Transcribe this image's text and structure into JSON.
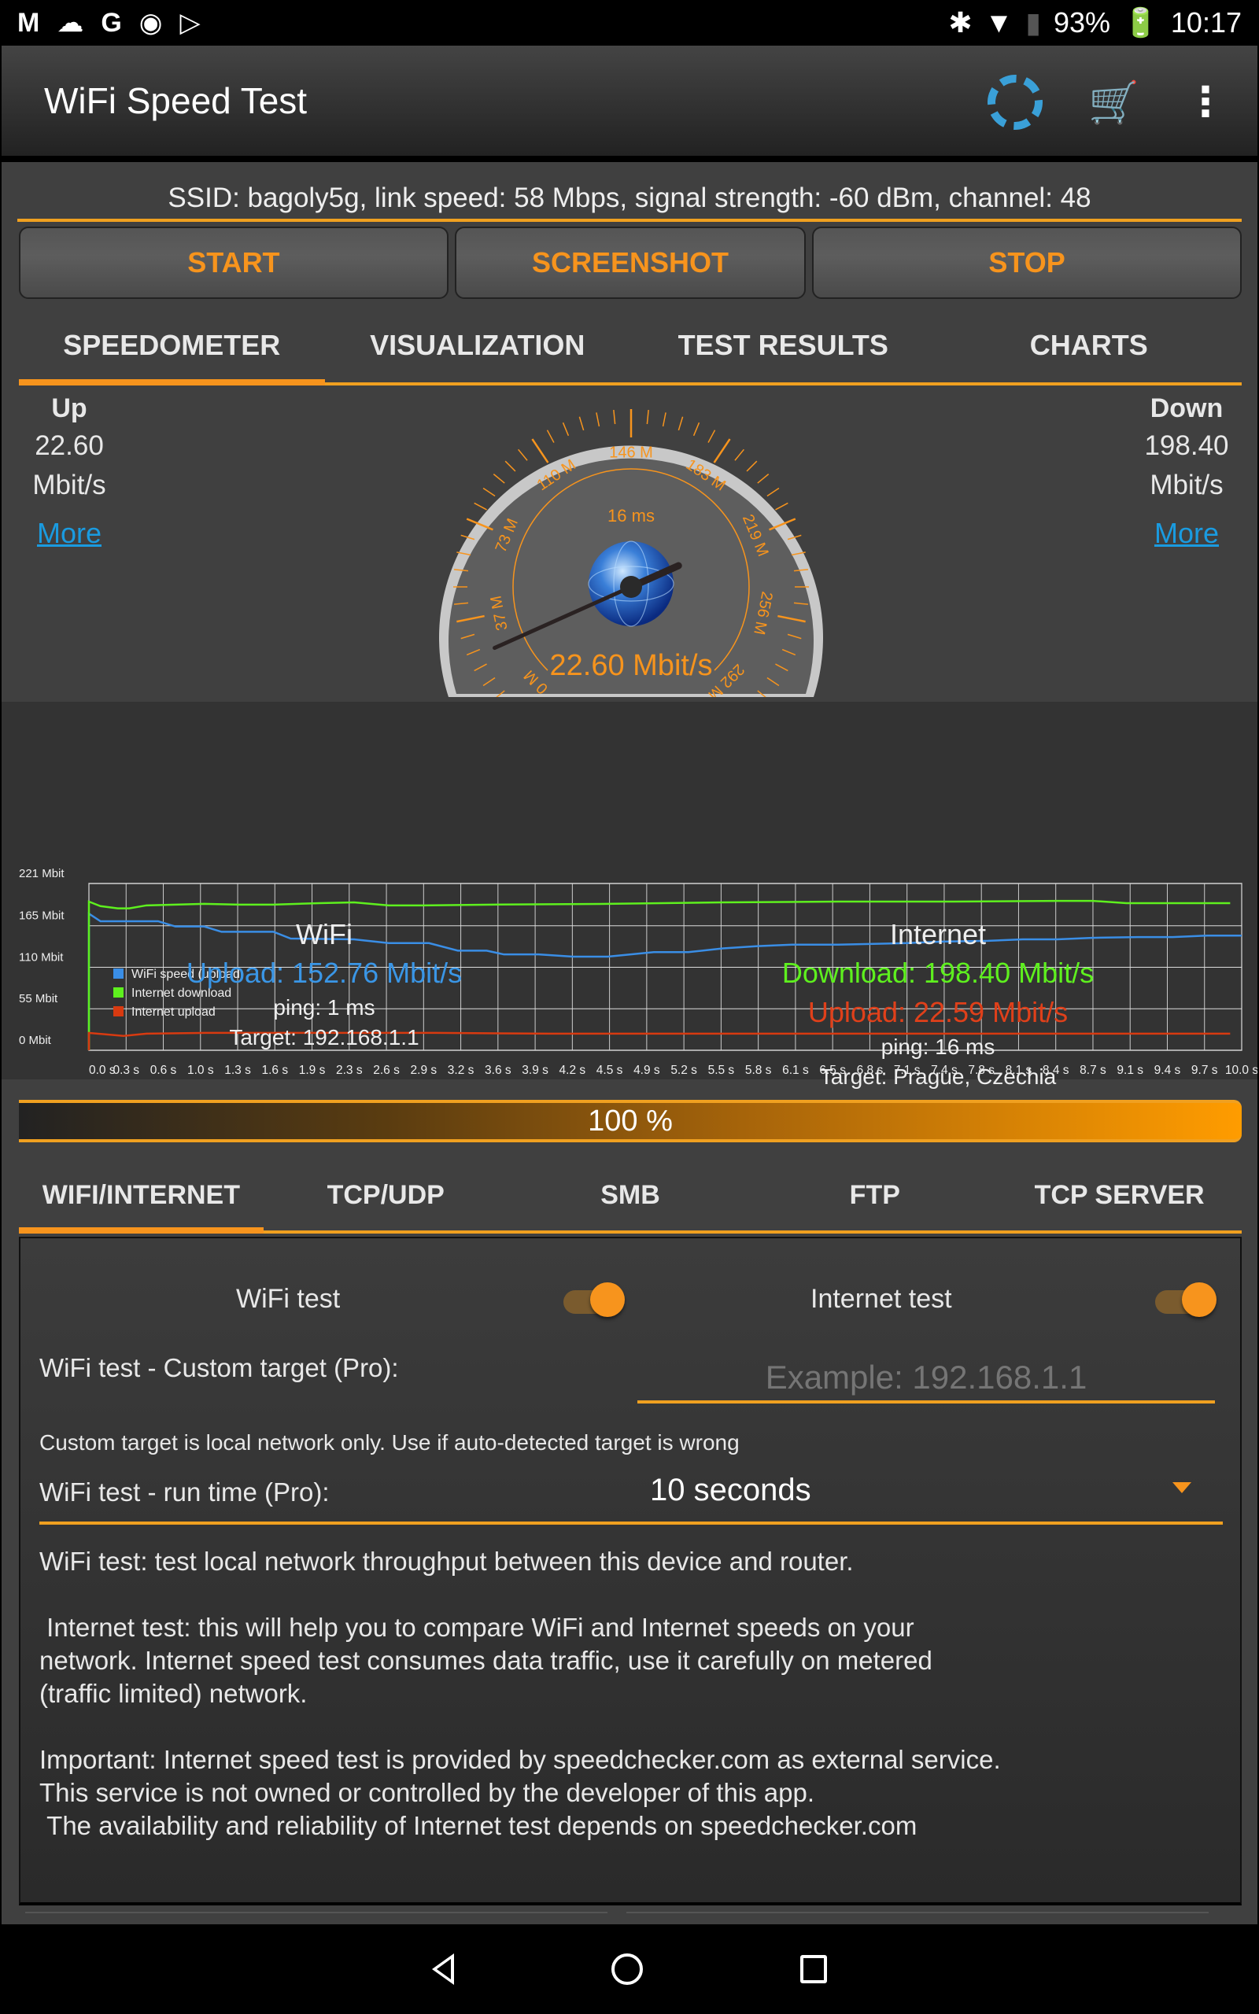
{
  "status_bar": {
    "notification_icons": [
      "gmail-icon",
      "cloud-icon",
      "google-icon",
      "circle-app-icon",
      "play-store-icon"
    ],
    "battery": "93%",
    "time": "10:17"
  },
  "app_bar": {
    "title": "WiFi Speed Test",
    "actions": [
      "settings-gear-icon",
      "cart-icon",
      "more-vert-icon"
    ]
  },
  "network_info": "SSID: bagoly5g, link speed: 58 Mbps, signal strength: -60 dBm, channel: 48",
  "buttons": {
    "start": "START",
    "screenshot": "SCREENSHOT",
    "stop": "STOP"
  },
  "top_tabs": [
    {
      "label": "SPEEDOMETER",
      "active": true
    },
    {
      "label": "VISUALIZATION",
      "active": false
    },
    {
      "label": "TEST RESULTS",
      "active": false
    },
    {
      "label": "CHARTS",
      "active": false
    }
  ],
  "speedometer": {
    "up": {
      "label": "Up",
      "value": "22.60",
      "unit": "Mbit/s",
      "more": "More"
    },
    "down": {
      "label": "Down",
      "value": "198.40",
      "unit": "Mbit/s",
      "more": "More"
    },
    "scale_labels": [
      "0 M",
      "37 M",
      "73 M",
      "110 M",
      "146 M",
      "183 M",
      "219 M",
      "256 M",
      "292 M"
    ],
    "scale_max": 292,
    "needle_value": 22.6,
    "ping": "16 ms",
    "readout": "22.60 Mbit/s",
    "accent_color": "#f7941d"
  },
  "chart_data": {
    "type": "line",
    "title": "",
    "xlabel": "",
    "ylabel": "",
    "ylim": [
      0,
      221
    ],
    "y_ticks": [
      "0 Mbit",
      "55 Mbit",
      "110 Mbit",
      "165 Mbit",
      "221 Mbit"
    ],
    "y_tick_values": [
      0,
      55,
      110,
      165,
      221
    ],
    "x_ticks": [
      "0.0 s",
      "0.3 s",
      "0.6 s",
      "1.0 s",
      "1.3 s",
      "1.6 s",
      "1.9 s",
      "2.3 s",
      "2.6 s",
      "2.9 s",
      "3.2 s",
      "3.6 s",
      "3.9 s",
      "4.2 s",
      "4.5 s",
      "4.9 s",
      "5.2 s",
      "5.5 s",
      "5.8 s",
      "6.1 s",
      "6.5 s",
      "6.8 s",
      "7.1 s",
      "7.4 s",
      "7.8 s",
      "8.1 s",
      "8.4 s",
      "8.7 s",
      "9.1 s",
      "9.4 s",
      "9.7 s",
      "10.0 s"
    ],
    "xlim": [
      0,
      10
    ],
    "grid": true,
    "legend_position": "bottom-left",
    "series": [
      {
        "name": "WiFi speed (upload)",
        "color": "#3a8ee6",
        "x": [
          0.0,
          0.1,
          0.3,
          0.6,
          0.75,
          1.0,
          1.15,
          1.6,
          1.75,
          2.3,
          2.6,
          2.95,
          3.2,
          3.45,
          3.6,
          3.9,
          4.2,
          4.5,
          4.9,
          5.2,
          5.5,
          5.8,
          6.1,
          6.5,
          7.1,
          7.4,
          7.8,
          8.1,
          8.4,
          8.7,
          9.1,
          9.4,
          9.7,
          10.0
        ],
        "values": [
          181,
          171,
          171,
          171,
          164,
          164,
          157,
          157,
          148,
          147,
          142,
          142,
          132,
          132,
          127,
          127,
          124,
          124,
          130,
          130,
          135,
          138,
          140,
          140,
          142,
          144,
          145,
          147,
          147,
          149,
          150,
          150,
          152,
          152
        ]
      },
      {
        "name": "Internet download",
        "color": "#5ef01e",
        "x": [
          0.0,
          0.1,
          0.25,
          0.35,
          0.5,
          0.75,
          1.0,
          1.3,
          1.6,
          2.0,
          2.3,
          2.6,
          2.9,
          3.5,
          4.5,
          5.5,
          6.5,
          7.5,
          8.4,
          8.7,
          9.0,
          9.4,
          9.7,
          9.9
        ],
        "values": [
          197,
          191,
          188,
          188,
          192,
          193,
          194,
          193,
          193,
          195,
          196,
          192,
          192,
          193,
          194,
          196,
          197,
          197,
          198,
          198,
          195,
          195,
          195,
          195
        ]
      },
      {
        "name": "Internet upload",
        "color": "#d83a10",
        "x": [
          0.0,
          0.3,
          0.5,
          1.0,
          2.0,
          3.0,
          4.0,
          5.0,
          6.0,
          7.0,
          8.0,
          9.0,
          9.9
        ],
        "values": [
          23,
          19,
          22,
          23,
          23,
          23,
          22,
          22,
          22,
          22,
          22,
          22,
          22
        ]
      }
    ]
  },
  "results": {
    "wifi": {
      "heading": "WiFi",
      "upload": "Upload: 152.76 Mbit/s",
      "ping": "ping: 1 ms",
      "target": "Target: 192.168.1.1"
    },
    "internet": {
      "heading": "Internet",
      "download": "Download: 198.40 Mbit/s",
      "upload": "Upload: 22.59 Mbit/s",
      "ping": "ping: 16 ms",
      "target": "Target: Prague, Czechia"
    }
  },
  "progress": {
    "label": "100 %",
    "percent": 100
  },
  "bottom_tabs": [
    {
      "label": "WIFI/INTERNET",
      "active": true
    },
    {
      "label": "TCP/UDP",
      "active": false
    },
    {
      "label": "SMB",
      "active": false
    },
    {
      "label": "FTP",
      "active": false
    },
    {
      "label": "TCP SERVER",
      "active": false
    }
  ],
  "settings": {
    "wifi_test": {
      "label": "WiFi test",
      "enabled": true
    },
    "internet_test": {
      "label": "Internet test",
      "enabled": true
    },
    "custom_target_label": "WiFi test - Custom target (Pro):",
    "custom_target_value": "",
    "custom_target_placeholder": "Example: 192.168.1.1",
    "custom_target_hint": "Custom target is local network only. Use if auto-detected target is wrong",
    "run_time_label": "WiFi test - run time (Pro):",
    "run_time_value": "10 seconds",
    "description": "WiFi test: test local network throughput between this device and router.\n\n Internet test: this will help you to compare WiFi and Internet speeds on your\nnetwork. Internet speed test consumes data traffic, use it carefully on metered\n(traffic limited) network.\n\nImportant: Internet speed test is provided by speedchecker.com as external service.\nThis service is not owned or controlled by the developer of this app.\n The availability and reliability of Internet test depends on speedchecker.com"
  },
  "nav_bar": [
    "back-icon",
    "home-icon",
    "recents-icon"
  ]
}
